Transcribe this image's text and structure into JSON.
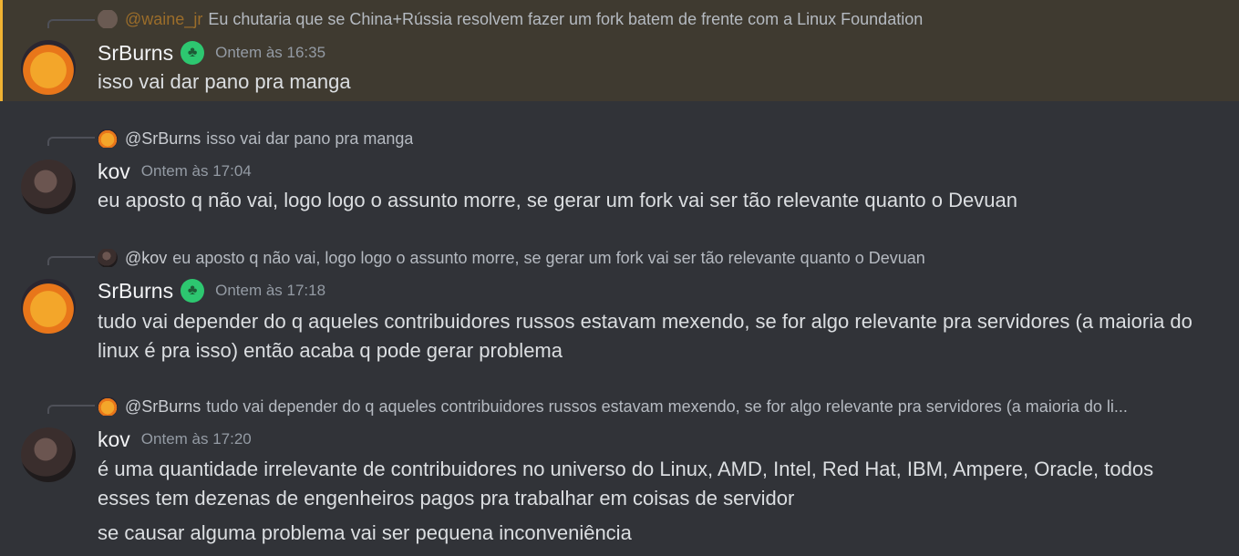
{
  "messages": [
    {
      "reply_mention": "@waine_jr",
      "reply_text": "Eu chutaria que se China+Rússia resolvem fazer um fork batem de frente com a Linux Foundation",
      "username": "SrBurns",
      "time": "Ontem às 16:35",
      "lines": [
        "isso vai dar pano pra manga"
      ]
    },
    {
      "reply_mention": "@SrBurns",
      "reply_text": "isso vai dar pano pra manga",
      "username": "kov",
      "time": "Ontem às 17:04",
      "lines": [
        "eu aposto q não vai, logo logo o assunto morre, se gerar um fork vai ser tão relevante quanto o Devuan"
      ]
    },
    {
      "reply_mention": "@kov",
      "reply_text": "eu aposto q não vai, logo logo o assunto morre, se gerar um fork vai ser tão relevante quanto o Devuan",
      "username": "SrBurns",
      "time": "Ontem às 17:18",
      "lines": [
        "tudo vai depender do q aqueles contribuidores russos estavam mexendo, se for algo relevante pra servidores (a maioria do",
        "linux é pra isso) então acaba q pode gerar problema"
      ]
    },
    {
      "reply_mention": "@SrBurns",
      "reply_text": "tudo vai depender do q aqueles contribuidores russos estavam mexendo, se for algo relevante pra servidores (a maioria do li...",
      "username": "kov",
      "time": "Ontem às 17:20",
      "lines": [
        "é uma quantidade irrelevante de contribuidores no universo do Linux, AMD, Intel, Red Hat, IBM, Ampere, Oracle, todos",
        "esses tem dezenas de engenheiros pagos pra trabalhar em coisas de servidor",
        "se causar alguma problema vai ser pequena inconveniência"
      ]
    }
  ]
}
